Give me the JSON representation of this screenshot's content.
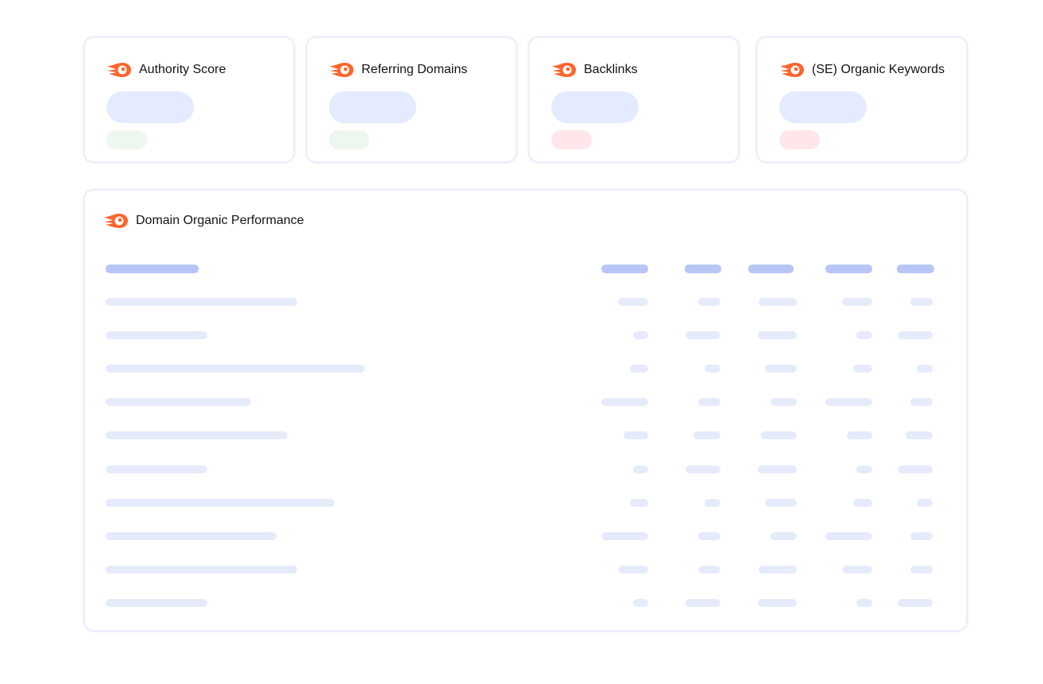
{
  "widgets": [
    {
      "title": "Authority Score",
      "trend": "up"
    },
    {
      "title": "Referring Domains",
      "trend": "up"
    },
    {
      "title": "Backlinks",
      "trend": "down"
    },
    {
      "title": "(SE) Organic Keywords",
      "trend": "down"
    }
  ],
  "performance": {
    "title": "Domain Organic Performance",
    "column_count": 5,
    "row_count": 10
  },
  "colors": {
    "brand_orange": "#ff642d",
    "skeleton": "#e4ebff",
    "skeleton_header": "#b9c6f5",
    "trend_up": "#edf7ef",
    "trend_down": "#ffe6ea",
    "card_border": "#eef0fc"
  },
  "icons": {
    "widget": "semrush-logo-icon"
  }
}
